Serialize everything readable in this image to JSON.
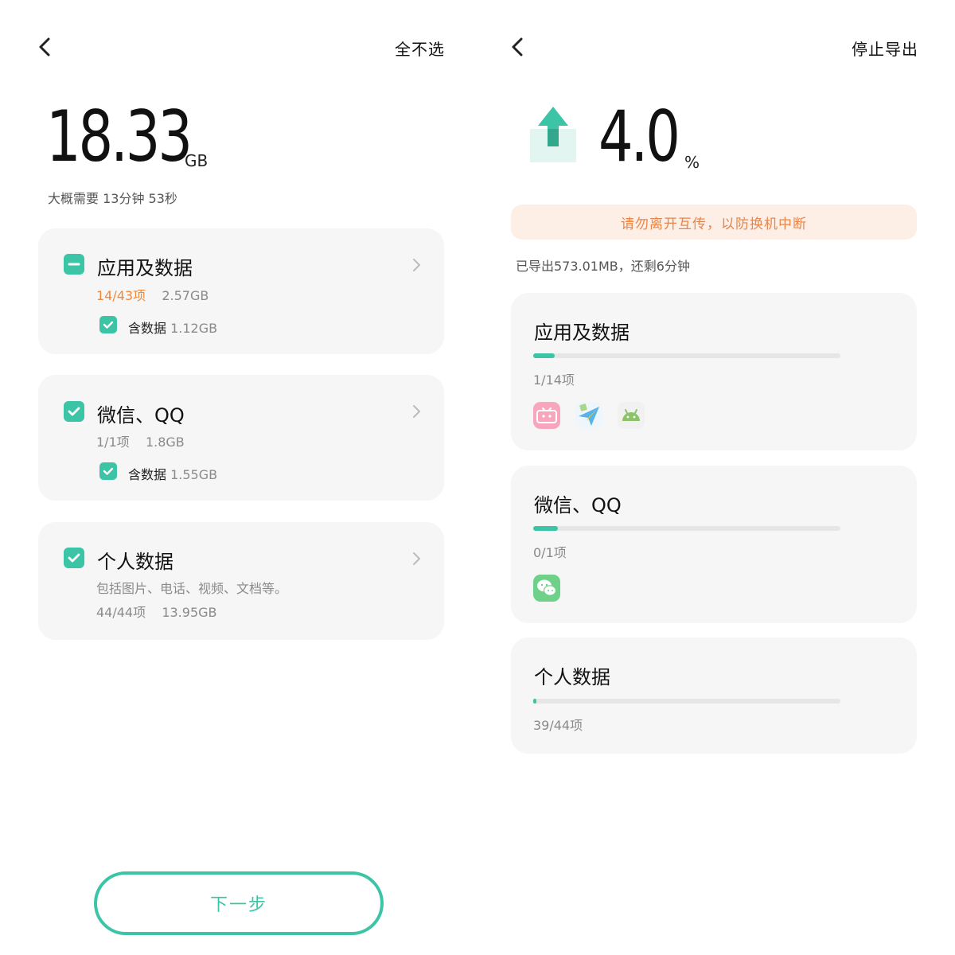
{
  "left": {
    "back_icon": "chevron-left-icon",
    "deselect_all": "全不选",
    "total_size": "18.33",
    "total_unit": "GB",
    "estimate": "大概需要 13分钟 53秒",
    "cards": [
      {
        "title": "应用及数据",
        "state": "partial",
        "count": "14/43项",
        "size": "2.57GB",
        "include_label": "含数据",
        "include_size": "1.12GB"
      },
      {
        "title": "微信、QQ",
        "state": "checked",
        "count": "1/1项",
        "size": "1.8GB",
        "include_label": "含数据",
        "include_size": "1.55GB"
      },
      {
        "title": "个人数据",
        "state": "checked",
        "description": "包括图片、电话、视频、文档等。",
        "count": "44/44项",
        "size": "13.95GB"
      }
    ],
    "next_button": "下一步"
  },
  "right": {
    "back_icon": "chevron-left-icon",
    "stop_export": "停止导出",
    "percent": "4.0",
    "percent_unit": "%",
    "warning": "请勿离开互传，以防换机中断",
    "status": "已导出573.01MB，还剩6分钟",
    "cards": [
      {
        "title": "应用及数据",
        "progress": 0.07,
        "count": "1/14项",
        "icons": [
          "bilibili-icon",
          "paper-plane-app-icon",
          "android-app-icon"
        ]
      },
      {
        "title": "微信、QQ",
        "progress": 0.08,
        "count": "0/1项",
        "icons": [
          "wechat-icon"
        ]
      },
      {
        "title": "个人数据",
        "progress": 0.01,
        "count": "39/44项",
        "icons": []
      }
    ]
  },
  "colors": {
    "accent": "#3cc4a6",
    "orange": "#f08a3a",
    "warning_bg": "#fdeee6",
    "card_bg": "#f6f6f6"
  }
}
